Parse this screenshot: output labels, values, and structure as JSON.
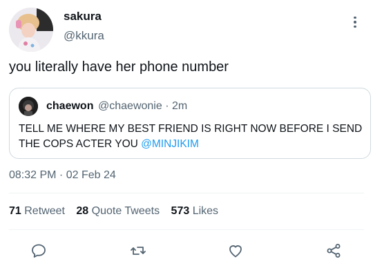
{
  "tweet": {
    "display_name": "sakura",
    "handle": "@kkura",
    "text": "you literally have her phone number",
    "timestamp": "08:32 PM · 02 Feb 24"
  },
  "quoted_tweet": {
    "display_name": "chaewon",
    "handle_time": "@chaewonie · 2m",
    "text_before": "TELL ME WHERE MY BEST FRIEND IS RIGHT NOW BEFORE I SEND THE COPS ACTER YOU ",
    "mention": "@MINJIKIM"
  },
  "stats": {
    "retweets_count": "71",
    "retweets_label": "Retweet",
    "quotes_count": "28",
    "quotes_label": "Quote Tweets",
    "likes_count": "573",
    "likes_label": "Likes"
  },
  "icons": {
    "more": "more-vertical-icon",
    "reply": "reply-icon",
    "retweet": "retweet-icon",
    "like": "heart-icon",
    "share": "share-icon"
  },
  "colors": {
    "text": "#0f1419",
    "secondary": "#536471",
    "link": "#1d9bf0",
    "border": "#cfd9de"
  }
}
